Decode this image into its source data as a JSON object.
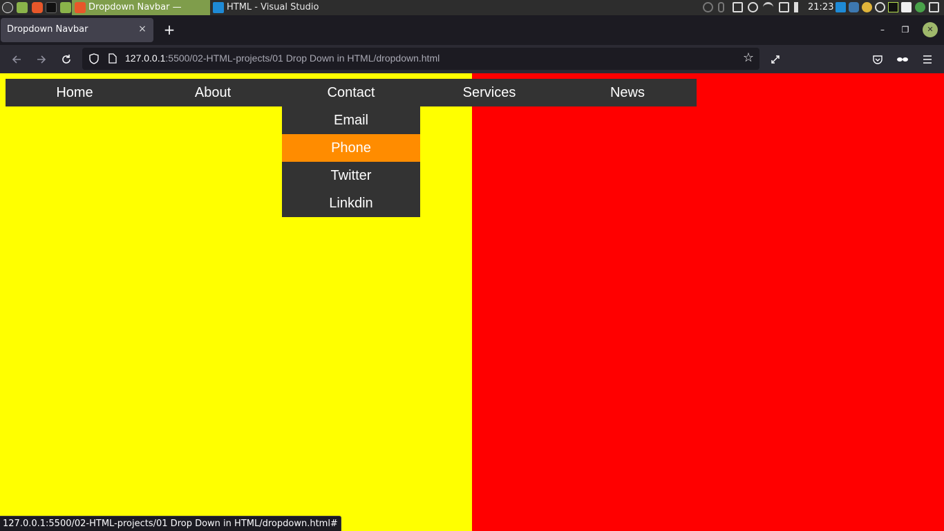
{
  "os_panel": {
    "taskbar": [
      {
        "label": "Dropdown Navbar — Moz…",
        "icon": "firefox-icon",
        "active": true
      },
      {
        "label": "HTML - Visual Studio Code",
        "icon": "vscode-icon",
        "active": false
      }
    ],
    "clock": "21:23"
  },
  "browser": {
    "tab_title": "Dropdown Navbar",
    "tab_close": "×",
    "new_tab": "+",
    "window_controls": {
      "minimize": "–",
      "restore": "❐",
      "close": "✕"
    },
    "url_host": "127.0.0.1",
    "url_rest": ":5500/02-HTML-projects/01 Drop Down in HTML/dropdown.html",
    "status_url": "127.0.0.1:5500/02-HTML-projects/01 Drop Down in HTML/dropdown.html#"
  },
  "page": {
    "colors": {
      "left_bg": "#ffff00",
      "right_bg": "#ff0000",
      "nav_bg": "#333333",
      "hover_bg": "#ff8c00",
      "text": "#ffffff"
    },
    "nav": [
      {
        "label": "Home"
      },
      {
        "label": "About"
      },
      {
        "label": "Contact"
      },
      {
        "label": "Services"
      },
      {
        "label": "News"
      }
    ],
    "dropdown_parent": "Contact",
    "dropdown": [
      {
        "label": "Email",
        "hovered": false
      },
      {
        "label": "Phone",
        "hovered": true
      },
      {
        "label": "Twitter",
        "hovered": false
      },
      {
        "label": "Linkdin",
        "hovered": false
      }
    ]
  }
}
